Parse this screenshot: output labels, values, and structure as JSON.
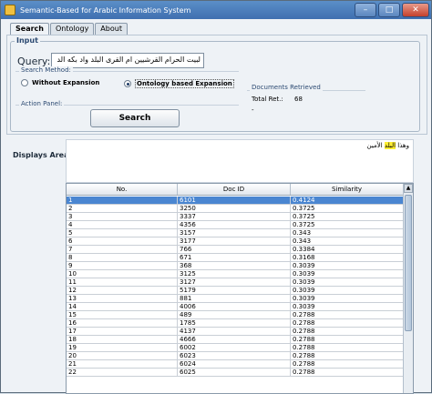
{
  "window": {
    "title": "Semantic-Based for Arabic Information System"
  },
  "tabs": [
    {
      "label": "Search"
    },
    {
      "label": "Ontology"
    },
    {
      "label": "About"
    }
  ],
  "input": {
    "legend": "Input",
    "query_label": "Query:",
    "query_value": "لبيت الحرام القرشيين ام القرى البلد واد بكه الد"
  },
  "search_method": {
    "legend": "Search Method:",
    "options": [
      {
        "label": "Without Expansion",
        "selected": false
      },
      {
        "label": "Ontology based Expansion",
        "selected": true
      }
    ]
  },
  "documents": {
    "legend": "Documents Retrieved",
    "total_label": "Total Ret.:",
    "total_value": "68",
    "extra": "-"
  },
  "action": {
    "legend": "Action Panel:",
    "search_label": "Search"
  },
  "displays": {
    "label": "Displays Area",
    "text_before": "وهذا ",
    "highlight": "البلد",
    "text_after": " الأمين"
  },
  "table": {
    "columns": [
      "No.",
      "Doc ID",
      "Similarity"
    ],
    "rows": [
      [
        "1",
        "6101",
        "0.4124"
      ],
      [
        "2",
        "3250",
        "0.3725"
      ],
      [
        "3",
        "3337",
        "0.3725"
      ],
      [
        "4",
        "4356",
        "0.3725"
      ],
      [
        "5",
        "3157",
        "0.343"
      ],
      [
        "6",
        "3177",
        "0.343"
      ],
      [
        "7",
        "766",
        "0.3384"
      ],
      [
        "8",
        "671",
        "0.3168"
      ],
      [
        "9",
        "368",
        "0.3039"
      ],
      [
        "10",
        "3125",
        "0.3039"
      ],
      [
        "11",
        "3127",
        "0.3039"
      ],
      [
        "12",
        "5179",
        "0.3039"
      ],
      [
        "13",
        "881",
        "0.3039"
      ],
      [
        "14",
        "4006",
        "0.3039"
      ],
      [
        "15",
        "489",
        "0.2788"
      ],
      [
        "16",
        "1785",
        "0.2788"
      ],
      [
        "17",
        "4137",
        "0.2788"
      ],
      [
        "18",
        "4666",
        "0.2788"
      ],
      [
        "19",
        "6002",
        "0.2788"
      ],
      [
        "20",
        "6023",
        "0.2788"
      ],
      [
        "21",
        "6024",
        "0.2788"
      ],
      [
        "22",
        "6025",
        "0.2788"
      ]
    ]
  }
}
